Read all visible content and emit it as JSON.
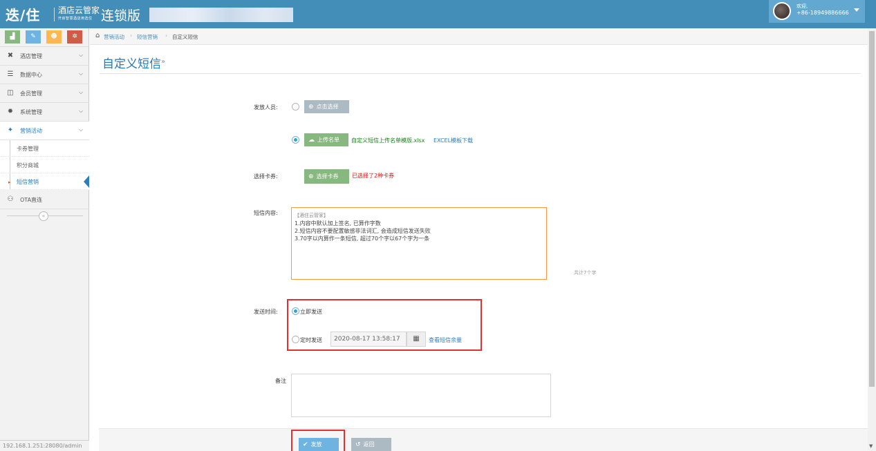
{
  "header": {
    "logo_main": "迭/住",
    "logo_name": "酒店云管家",
    "logo_slogan": "开启智慧酒店用选住",
    "edition": "连锁版",
    "user": {
      "welcome": "欢迎,",
      "phone": "+86-18949886666"
    }
  },
  "sidebar": {
    "shortcuts": [
      {
        "icon": "signal-icon",
        "glyph": "▟",
        "color": "#87b87f"
      },
      {
        "icon": "pencil-icon",
        "glyph": "✎",
        "color": "#6fb3e0"
      },
      {
        "icon": "users-icon",
        "glyph": "☻",
        "color": "#ffb752"
      },
      {
        "icon": "cogs-icon",
        "glyph": "✲",
        "color": "#d15b47"
      }
    ],
    "items": [
      {
        "label": "酒店管理",
        "glyph": "✖",
        "icon": "cutlery-icon"
      },
      {
        "label": "数据中心",
        "glyph": "☰",
        "icon": "database-icon"
      },
      {
        "label": "会员管理",
        "glyph": "◫",
        "icon": "vip-card-icon"
      },
      {
        "label": "系统管理",
        "glyph": "✹",
        "icon": "cog-icon"
      },
      {
        "label": "营销活动",
        "glyph": "✦",
        "icon": "gift-icon"
      }
    ],
    "subitems": [
      {
        "label": "卡券管理"
      },
      {
        "label": "积分商城"
      },
      {
        "label": "短信营销"
      }
    ],
    "ota": {
      "label": "OTA直连",
      "glyph": "⚇",
      "icon": "handshake-icon"
    },
    "url_status": "192.168.1.251:28080/admin"
  },
  "breadcrumb": {
    "items": [
      "营销活动",
      "短信营销",
      "自定义短信"
    ]
  },
  "page": {
    "title": "自定义短信",
    "title_arrow": "»"
  },
  "form": {
    "recipients_label": "发放人员:",
    "select_button": "点击选择",
    "upload_button": "上传名单",
    "uploaded_file": "自定义短信上传名单模版.xlsx",
    "excel_template_link": "EXCEL模板下载",
    "coupon_label": "选择卡券:",
    "coupon_button": "选择卡券",
    "coupon_selected": "已选择了2种卡券",
    "sms_label": "短信内容:",
    "sms_signature": "【酒住云管家】",
    "sms_lines": [
      "1.内容中默认加上签名, 已算作字数",
      "2.短信内容不要配置敏感非法词汇, 会造成短信发送失败",
      "3.70字以内算作一条短信, 超过70个字以67个字为一条"
    ],
    "char_count": "共计7个字",
    "send_time_label": "发送时间:",
    "send_now": "立即发送",
    "send_scheduled": "定时发送",
    "scheduled_datetime": "2020-08-17 13:58:17",
    "check_balance_link": "查看短信余量",
    "remark_label": "备注",
    "send_button": "发放",
    "back_button": "返回"
  },
  "colors": {
    "header_bg": "#438eb9",
    "accent_blue": "#2679b5",
    "green_btn": "#87b87f",
    "blue_btn": "#6fb3e0",
    "grey_btn": "#abbac3",
    "highlight_red": "#e03030",
    "text_red": "#e01010"
  }
}
